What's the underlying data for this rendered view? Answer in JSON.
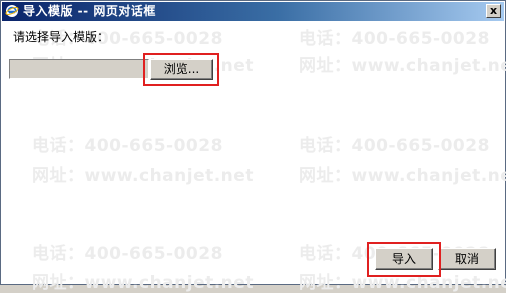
{
  "window": {
    "title": "导入模版 -- 网页对话框",
    "close_glyph": "x"
  },
  "form": {
    "prompt": "请选择导入模版：",
    "file_value": "",
    "browse_label": "浏览..."
  },
  "footer": {
    "import_label": "导入",
    "cancel_label": "取消"
  },
  "watermark": {
    "phone": "电话：400-665-0028",
    "site": "网址：www.chanjet.net"
  },
  "colors": {
    "highlight": "#e02020",
    "titlebar_start": "#0a246a",
    "titlebar_end": "#a6caf0"
  }
}
